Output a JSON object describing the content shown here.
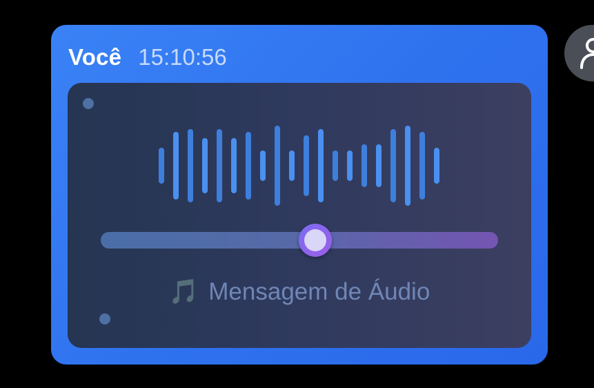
{
  "message": {
    "sender": "Você",
    "time": "15:10:56"
  },
  "audio": {
    "label": "Mensagem de Áudio",
    "icon": "musical-note-icon",
    "progress": 0.54,
    "waveform_levels": [
      0.45,
      0.84,
      0.92,
      0.69,
      0.92,
      0.69,
      0.84,
      0.38,
      1.0,
      0.38,
      0.76,
      0.92,
      0.38,
      0.38,
      0.53,
      0.53,
      0.92,
      1.0,
      0.84,
      0.45
    ],
    "waveform_colors": [
      "#3f7fdc",
      "#4a90f0",
      "#3f7fdc",
      "#4a90f0"
    ]
  },
  "avatar": {
    "icon": "user-icon"
  },
  "colors": {
    "bubble": "#3178f0",
    "card": "#2b3856",
    "slider_start": "#4a6ea8",
    "slider_end": "#7455b2",
    "caption": "#6f86b6"
  }
}
